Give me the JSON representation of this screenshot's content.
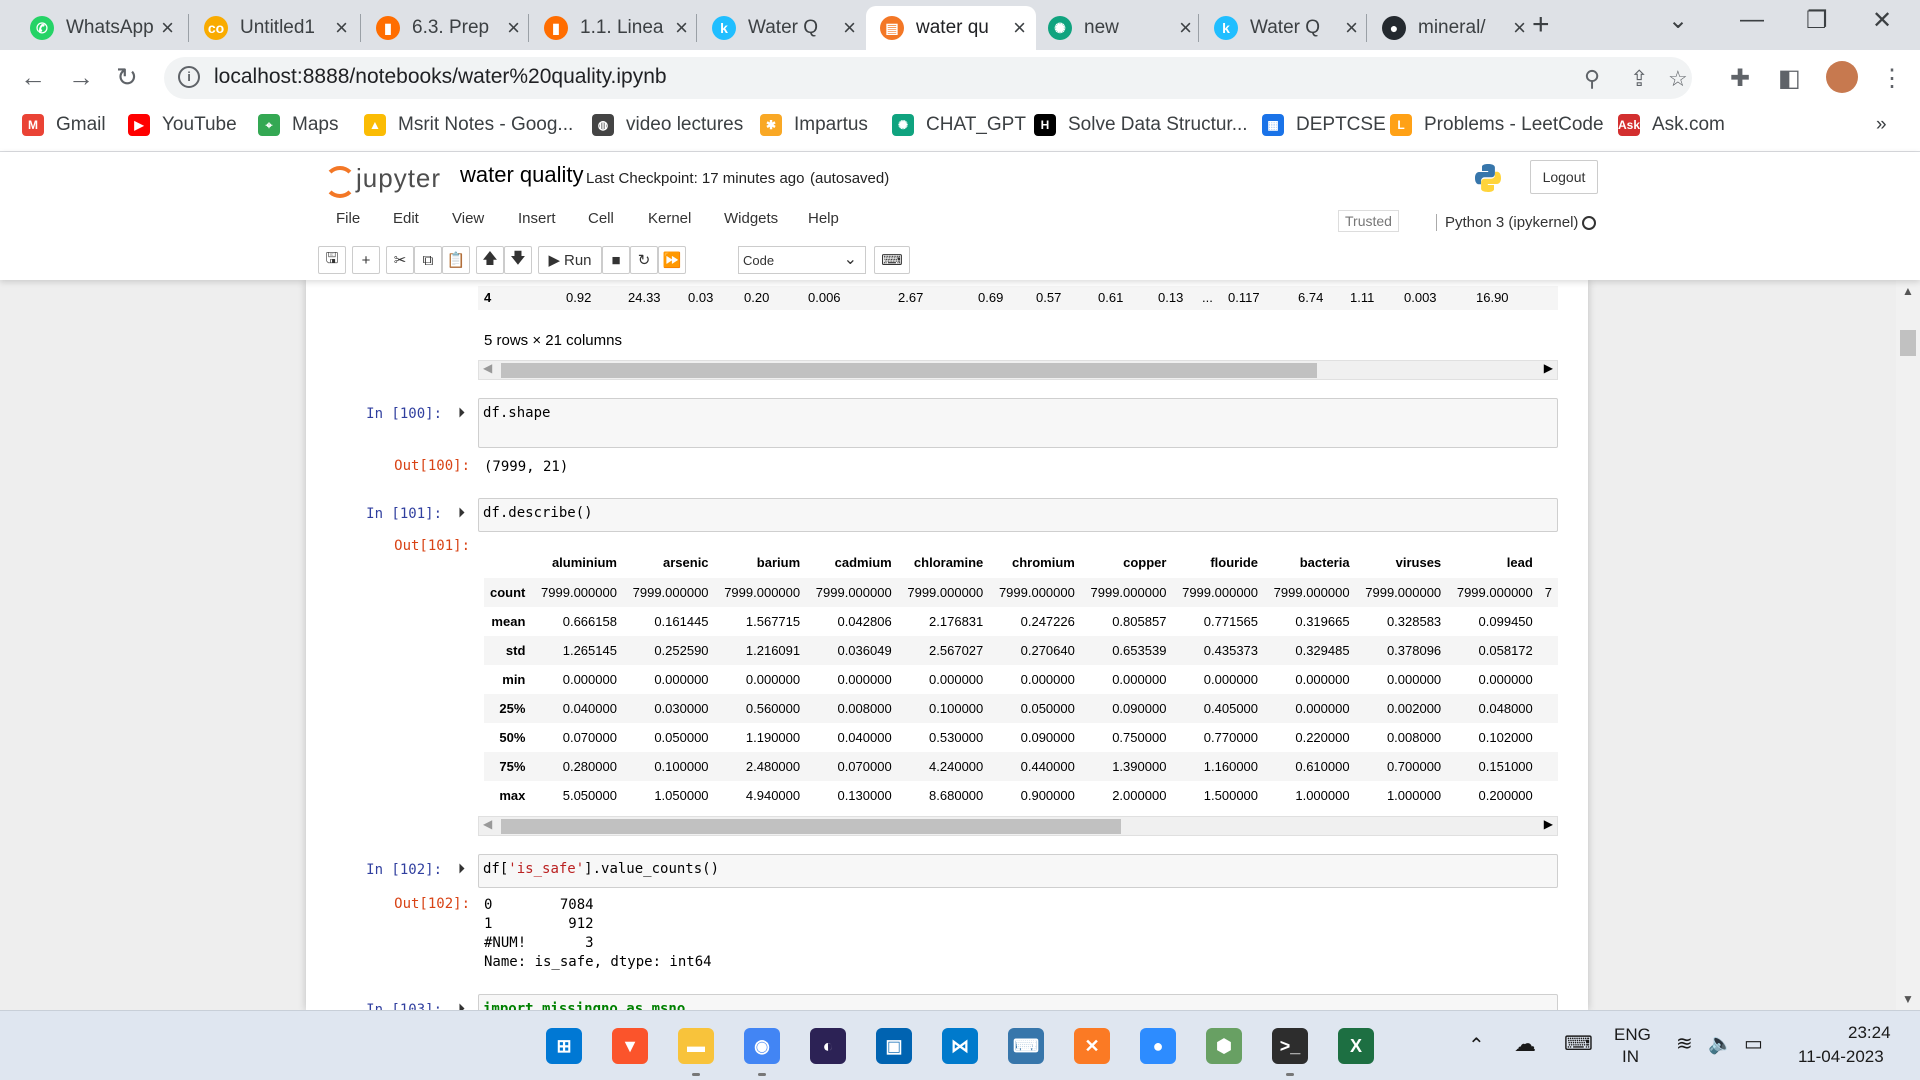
{
  "browser": {
    "tabs": [
      {
        "title": "WhatsApp",
        "fav_color": "#25d366",
        "fav_glyph": "✆",
        "icon": "whatsapp-icon"
      },
      {
        "title": "Untitled1",
        "fav_color": "#f9ab00",
        "fav_glyph": "co",
        "icon": "colab-icon"
      },
      {
        "title": "6.3. Prep",
        "fav_color": "#ff6d00",
        "fav_glyph": "▮",
        "icon": "chart-icon"
      },
      {
        "title": "1.1. Linea",
        "fav_color": "#ff6d00",
        "fav_glyph": "▮",
        "icon": "chart-icon"
      },
      {
        "title": "Water Q",
        "fav_color": "#20beff",
        "fav_glyph": "k",
        "icon": "kaggle-icon"
      },
      {
        "title": "water qu",
        "fav_color": "#f37726",
        "fav_glyph": "▤",
        "icon": "jupyter-icon"
      },
      {
        "title": "new",
        "fav_color": "#10a37f",
        "fav_glyph": "✺",
        "icon": "chatgpt-icon"
      },
      {
        "title": "Water Q",
        "fav_color": "#20beff",
        "fav_glyph": "k",
        "icon": "kaggle-icon"
      },
      {
        "title": "mineral/",
        "fav_color": "#24292f",
        "fav_glyph": "●",
        "icon": "github-icon"
      }
    ],
    "active_tab": 5,
    "url": "localhost:8888/notebooks/water%20quality.ipynb",
    "bookmarks": [
      {
        "label": "Gmail",
        "color": "#ea4335",
        "glyph": "M"
      },
      {
        "label": "YouTube",
        "color": "#ff0000",
        "glyph": "▶"
      },
      {
        "label": "Maps",
        "color": "#34a853",
        "glyph": "⌖"
      },
      {
        "label": "Msrit Notes - Goog...",
        "color": "#fbbc04",
        "glyph": "▲"
      },
      {
        "label": "video lectures",
        "color": "#444444",
        "glyph": "◍"
      },
      {
        "label": "Impartus",
        "color": "#f9a825",
        "glyph": "✱"
      },
      {
        "label": "CHAT_GPT",
        "color": "#10a37f",
        "glyph": "✺"
      },
      {
        "label": "Solve Data Structur...",
        "color": "#000000",
        "glyph": "H"
      },
      {
        "label": "DEPTCSE",
        "color": "#1a73e8",
        "glyph": "▦"
      },
      {
        "label": "Problems - LeetCode",
        "color": "#ffa116",
        "glyph": "L"
      },
      {
        "label": "Ask.com",
        "color": "#d32f2f",
        "glyph": "Ask"
      }
    ],
    "bookmarks_more": "»"
  },
  "jupyter": {
    "logo_text": "jupyter",
    "notebook_name": "water quality",
    "checkpoint": "Last Checkpoint: 17 minutes ago",
    "autosave": "(autosaved)",
    "logout": "Logout",
    "menus": [
      "File",
      "Edit",
      "View",
      "Insert",
      "Cell",
      "Kernel",
      "Widgets",
      "Help"
    ],
    "trusted": "Trusted",
    "kernel": "Python 3 (ipykernel)",
    "run_label": "Run",
    "cell_type": "Code"
  },
  "notebook": {
    "prev_row": {
      "index": "4",
      "values": [
        "0.92",
        "24.33",
        "0.03",
        "0.20",
        "0.006",
        "2.67",
        "0.69",
        "0.57",
        "0.61",
        "0.13",
        "...",
        "0.117",
        "6.74",
        "1.11",
        "0.003",
        "16.90"
      ]
    },
    "prev_summary": "5 rows × 21 columns",
    "cells": [
      {
        "in_prompt": "In [100]:",
        "code": "df.shape",
        "out_prompt": "Out[100]:",
        "output": "(7999, 21)"
      },
      {
        "in_prompt": "In [101]:",
        "code": "df.describe()",
        "out_prompt": "Out[101]:"
      },
      {
        "in_prompt": "In [102]:",
        "code_prefix": "df[",
        "code_string": "'is_safe'",
        "code_suffix": "].value_counts()",
        "out_prompt": "Out[102]:",
        "output": "0        7084\n1         912\n#NUM!       3\nName: is_safe, dtype: int64"
      },
      {
        "in_prompt": "In [103]:",
        "code": "import missingno as msno"
      }
    ],
    "describe": {
      "columns": [
        "aluminium",
        "arsenic",
        "barium",
        "cadmium",
        "chloramine",
        "chromium",
        "copper",
        "flouride",
        "bacteria",
        "viruses",
        "lead"
      ],
      "trailing": "7",
      "rows": [
        {
          "label": "count",
          "values": [
            "7999.000000",
            "7999.000000",
            "7999.000000",
            "7999.000000",
            "7999.000000",
            "7999.000000",
            "7999.000000",
            "7999.000000",
            "7999.000000",
            "7999.000000",
            "7999.000000"
          ]
        },
        {
          "label": "mean",
          "values": [
            "0.666158",
            "0.161445",
            "1.567715",
            "0.042806",
            "2.176831",
            "0.247226",
            "0.805857",
            "0.771565",
            "0.319665",
            "0.328583",
            "0.099450"
          ]
        },
        {
          "label": "std",
          "values": [
            "1.265145",
            "0.252590",
            "1.216091",
            "0.036049",
            "2.567027",
            "0.270640",
            "0.653539",
            "0.435373",
            "0.329485",
            "0.378096",
            "0.058172"
          ]
        },
        {
          "label": "min",
          "values": [
            "0.000000",
            "0.000000",
            "0.000000",
            "0.000000",
            "0.000000",
            "0.000000",
            "0.000000",
            "0.000000",
            "0.000000",
            "0.000000",
            "0.000000"
          ]
        },
        {
          "label": "25%",
          "values": [
            "0.040000",
            "0.030000",
            "0.560000",
            "0.008000",
            "0.100000",
            "0.050000",
            "0.090000",
            "0.405000",
            "0.000000",
            "0.002000",
            "0.048000"
          ]
        },
        {
          "label": "50%",
          "values": [
            "0.070000",
            "0.050000",
            "1.190000",
            "0.040000",
            "0.530000",
            "0.090000",
            "0.750000",
            "0.770000",
            "0.220000",
            "0.008000",
            "0.102000"
          ]
        },
        {
          "label": "75%",
          "values": [
            "0.280000",
            "0.100000",
            "2.480000",
            "0.070000",
            "4.240000",
            "0.440000",
            "1.390000",
            "1.160000",
            "0.610000",
            "0.700000",
            "0.151000"
          ]
        },
        {
          "label": "max",
          "values": [
            "5.050000",
            "1.050000",
            "4.940000",
            "0.130000",
            "8.680000",
            "0.900000",
            "2.000000",
            "1.500000",
            "1.000000",
            "1.000000",
            "0.200000"
          ]
        }
      ]
    }
  },
  "taskbar": {
    "apps": [
      {
        "name": "windows-start-icon",
        "color": "#0078d4",
        "glyph": "⊞"
      },
      {
        "name": "brave-icon",
        "color": "#fb542b",
        "glyph": "▼"
      },
      {
        "name": "file-explorer-icon",
        "color": "#f8c33b",
        "glyph": "▬"
      },
      {
        "name": "chrome-icon",
        "color": "#4285f4",
        "glyph": "◉"
      },
      {
        "name": "eclipse-icon",
        "color": "#2c2255",
        "glyph": "◐"
      },
      {
        "name": "remote-desktop-icon",
        "color": "#0063b1",
        "glyph": "▣"
      },
      {
        "name": "vscode-icon",
        "color": "#007acc",
        "glyph": "⋈"
      },
      {
        "name": "python-idle-icon",
        "color": "#3776ab",
        "glyph": "⌨"
      },
      {
        "name": "xampp-icon",
        "color": "#fb7a24",
        "glyph": "✕"
      },
      {
        "name": "zoom-icon",
        "color": "#2d8cff",
        "glyph": "●"
      },
      {
        "name": "nodejs-icon",
        "color": "#68a063",
        "glyph": "⬢"
      },
      {
        "name": "terminal-icon",
        "color": "#2d2d2d",
        "glyph": ">_"
      },
      {
        "name": "excel-icon",
        "color": "#1d6f42",
        "glyph": "X"
      }
    ],
    "language": "ENG",
    "region": "IN",
    "time": "23:24",
    "date": "11-04-2023"
  }
}
